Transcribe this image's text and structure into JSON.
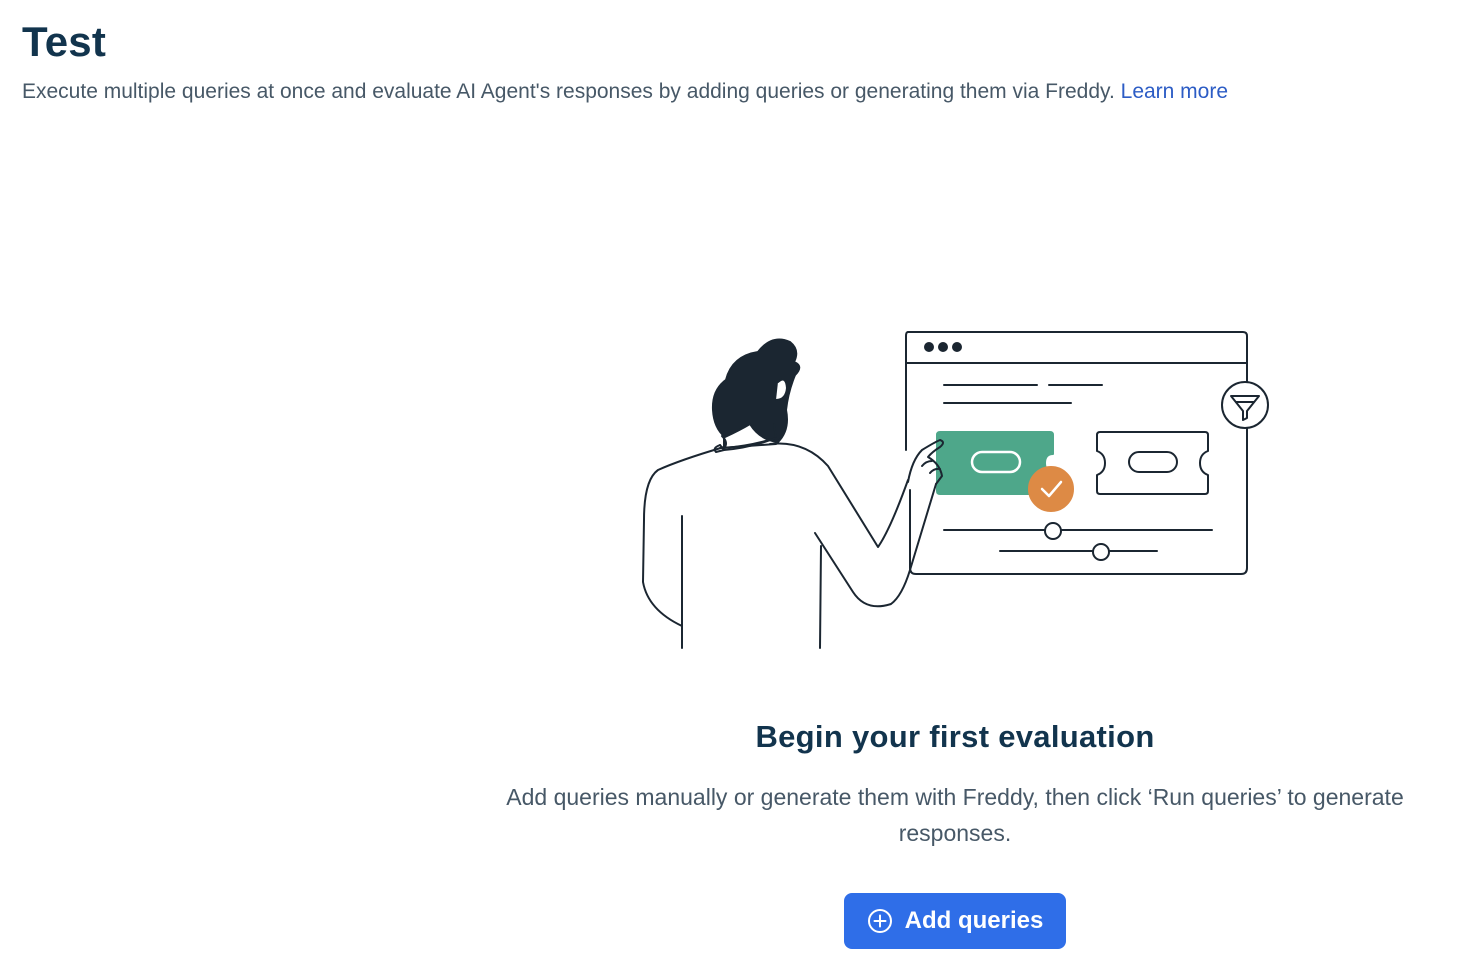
{
  "header": {
    "title": "Test",
    "description": "Execute multiple queries at once and evaluate AI Agent's responses by adding queries or generating them via Freddy.",
    "learn_more": "Learn more"
  },
  "empty_state": {
    "title": "Begin your first evaluation",
    "text": "Add queries manually or generate them with Freddy, then click ‘Run queries’ to generate responses.",
    "button_label": "Add queries",
    "button_icon": "plus-circle-icon",
    "illustration": "person-selecting-query-card-illustration"
  },
  "colors": {
    "title": "#12344d",
    "body_text": "#475867",
    "link": "#2c5cc5",
    "button": "#2f6ee8",
    "card_green": "#4ea78a",
    "check_orange": "#dd8a45"
  }
}
